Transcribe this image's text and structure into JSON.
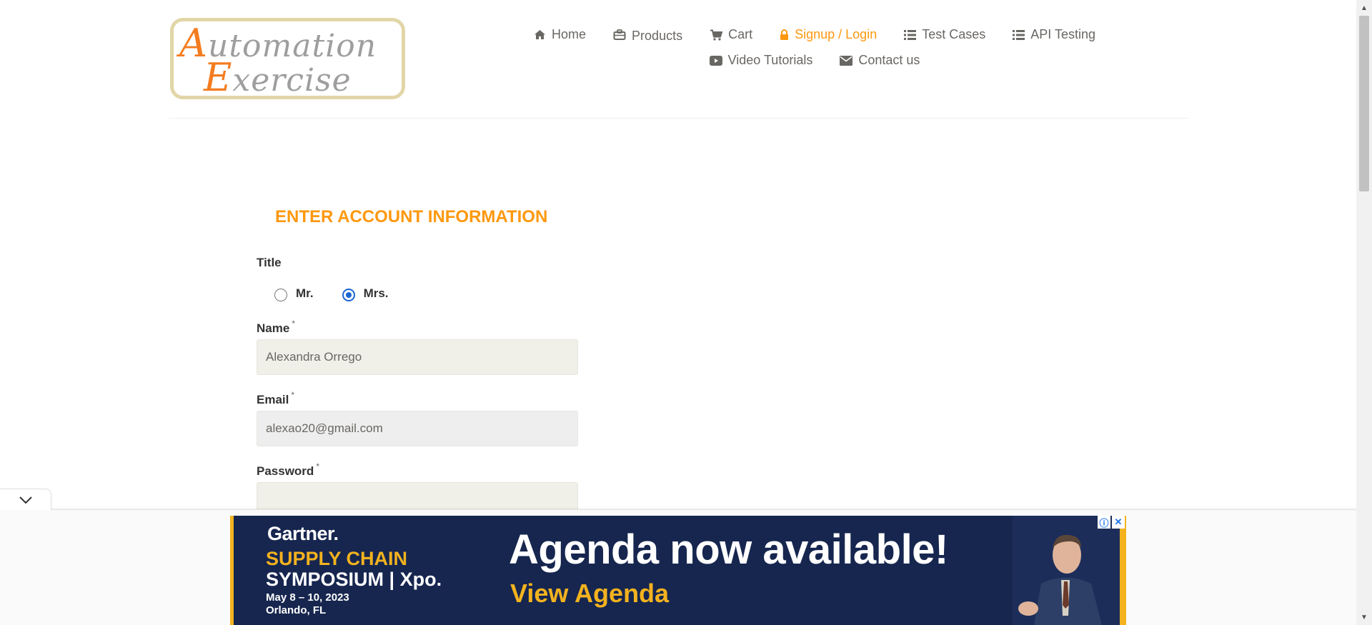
{
  "logo": {
    "line1_cap": "A",
    "line1_rest": "utomation",
    "line2_cap": "E",
    "line2_rest": "xercise"
  },
  "nav": {
    "items": [
      {
        "label": "Home",
        "icon": "home-icon"
      },
      {
        "label": "Products",
        "icon": "products-icon"
      },
      {
        "label": "Cart",
        "icon": "cart-icon"
      },
      {
        "label": "Signup / Login",
        "icon": "lock-icon",
        "active": true
      },
      {
        "label": "Test Cases",
        "icon": "list-icon"
      },
      {
        "label": "API Testing",
        "icon": "list-icon"
      },
      {
        "label": "Video Tutorials",
        "icon": "youtube-icon"
      },
      {
        "label": "Contact us",
        "icon": "envelope-icon"
      }
    ]
  },
  "form": {
    "heading": "ENTER ACCOUNT INFORMATION",
    "title_label": "Title",
    "options": [
      {
        "label": "Mr.",
        "checked": false
      },
      {
        "label": "Mrs.",
        "checked": true
      }
    ],
    "name_label": "Name",
    "name_value": "Alexandra Orrego",
    "email_label": "Email",
    "email_value": "alexao20@gmail.com",
    "password_label": "Password",
    "password_value": "",
    "required_mark": "*"
  },
  "ad": {
    "brand": "Gartner.",
    "event_line1": "SUPPLY CHAIN",
    "event_line2": "SYMPOSIUM | Xpo.",
    "date": "May 8 – 10, 2023",
    "place": "Orlando, FL",
    "headline": "Agenda now available!",
    "cta": "View Agenda",
    "info_icon": "ⓘ",
    "close_icon": "✕"
  },
  "colors": {
    "accent": "#fe980f",
    "text": "#696763",
    "input_bg": "#f0f0e9",
    "ad_bg": "#16264f",
    "ad_yellow": "#f3b21e"
  }
}
